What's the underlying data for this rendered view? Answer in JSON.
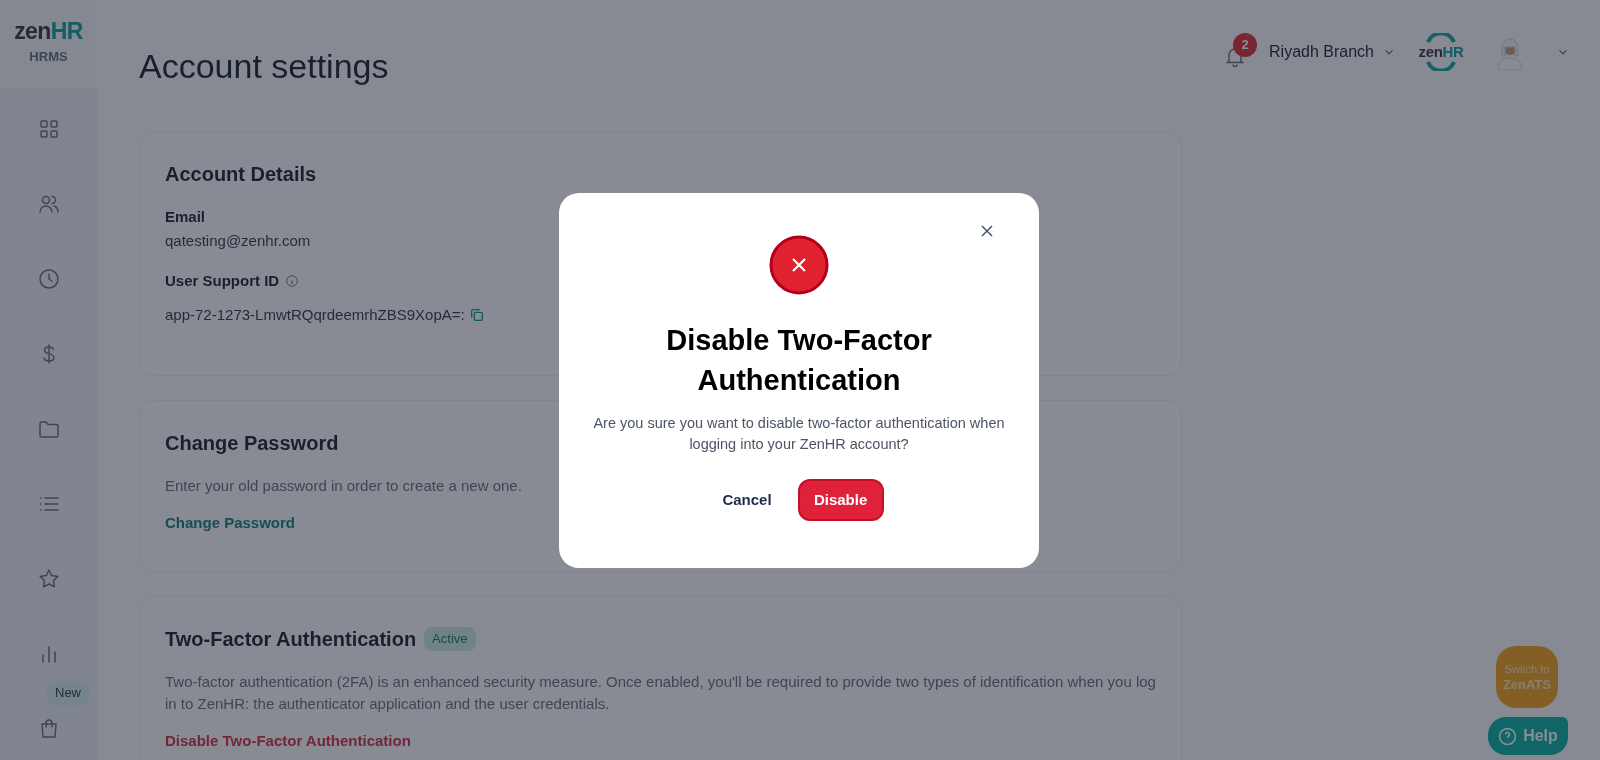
{
  "sidebar": {
    "logo": {
      "text": "zen",
      "accent": "HR"
    },
    "product": "HRMS",
    "items": [
      {
        "kind": "grid"
      },
      {
        "kind": "users"
      },
      {
        "kind": "clock"
      },
      {
        "kind": "dollar"
      },
      {
        "kind": "folder"
      },
      {
        "kind": "list"
      },
      {
        "kind": "star"
      },
      {
        "kind": "chart"
      },
      {
        "kind": "bag",
        "badge": "New"
      }
    ]
  },
  "header": {
    "title": "Account settings",
    "notifications": "2",
    "branch": "Riyadh Branch",
    "brand_logo": {
      "text": "zen",
      "accent": "HR"
    }
  },
  "cards": [
    {
      "kind": "details",
      "title": "Account Details",
      "fields": [
        {
          "label": "Email",
          "value": "qatesting@zenhr.com"
        },
        {
          "label": "User Support ID",
          "value": "app-72-1273-LmwtRQqrdeemrhZBS9XopA=:",
          "info": true,
          "copy": true
        }
      ]
    },
    {
      "kind": "password",
      "title": "Change Password",
      "description": "Enter your old password in order to create a new one.",
      "link": {
        "text": "Change Password"
      }
    },
    {
      "kind": "two_factor",
      "title": "Two-Factor Authentication",
      "badge": "Active",
      "description": "Two-factor authentication (2FA) is an enhanced security measure. Once enabled, you'll be required to provide two types of identification when you log in to ZenHR: the authenticator application and the user credentials.",
      "link": {
        "text": "Disable Two-Factor Authentication"
      }
    }
  ],
  "dialog": {
    "title": "Disable Two-Factor Authentication",
    "message": "Are you sure you want to disable two-factor authentication when logging into your ZenHR account?",
    "cancel": "Cancel",
    "confirm": "Disable"
  },
  "floating": {
    "switch_label": "Switch to",
    "switch_app": "ZenATS",
    "help": "Help"
  }
}
